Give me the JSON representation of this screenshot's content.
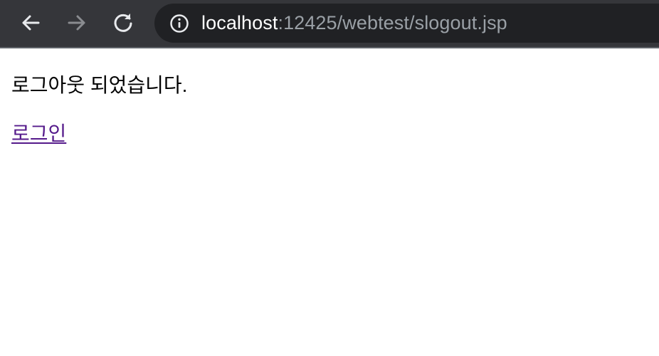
{
  "browser": {
    "back_icon": "arrow-left-icon",
    "forward_icon": "arrow-right-icon",
    "reload_icon": "reload-icon",
    "info_icon": "info-icon",
    "url_host": "localhost",
    "url_rest": ":12425/webtest/slogout.jsp",
    "colors": {
      "toolbar_bg": "#35363a",
      "omnibox_bg": "#202124",
      "host_text": "#ffffff",
      "path_text": "#9aa0a6"
    }
  },
  "page": {
    "message": "로그아웃 되었습니다.",
    "login_link": "로그인",
    "colors": {
      "link": "#551a8b"
    }
  }
}
